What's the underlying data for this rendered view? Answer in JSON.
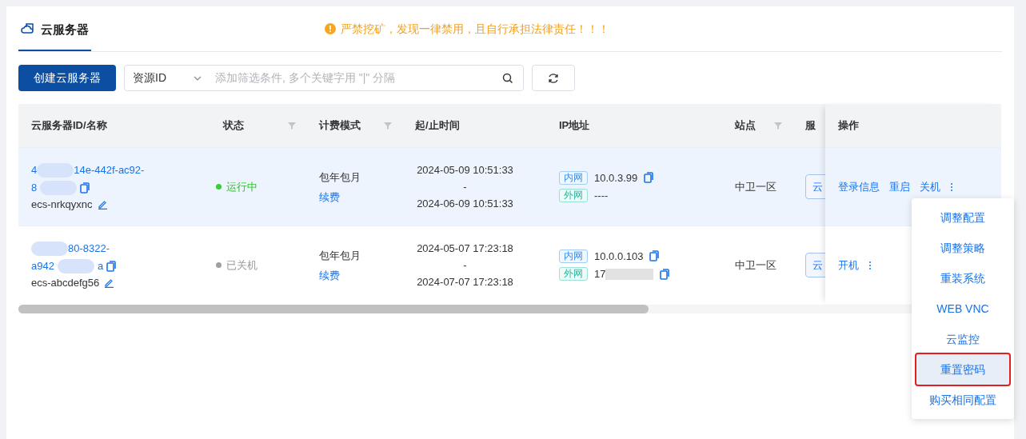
{
  "tab": {
    "label": "云服务器",
    "selected": true
  },
  "notice": "严禁挖矿，发现一律禁用，且自行承担法律责任！！！",
  "toolbar": {
    "create_button": "创建云服务器",
    "filter_key": "资源ID",
    "search_placeholder": "添加筛选条件, 多个关键字用 \"|\" 分隔"
  },
  "table": {
    "columns": [
      {
        "label": "云服务器ID/名称"
      },
      {
        "label": "状态",
        "filter": true
      },
      {
        "label": "计费模式",
        "filter": true
      },
      {
        "label": "起/止时间"
      },
      {
        "label": "IP地址"
      },
      {
        "label": "站点",
        "filter": true
      },
      {
        "label": "服"
      },
      {
        "label": "操作"
      }
    ],
    "rows": [
      {
        "id_line1": [
          {
            "kind": "text",
            "text": "4"
          },
          {
            "kind": "redacted"
          },
          {
            "kind": "text",
            "text": "14e-442f-ac92-"
          }
        ],
        "id_line2": [
          {
            "kind": "text",
            "text": "8"
          },
          {
            "kind": "redacted"
          }
        ],
        "name": "ecs-nrkqyxnc",
        "status": "运行中",
        "running": true,
        "billing": "包年包月",
        "renew": "续费",
        "start": "2024-05-09 10:51:33",
        "dash": "-",
        "end": "2024-06-09 10:51:33",
        "ips": [
          {
            "tag": "内网",
            "kind": "inner",
            "value": "10.0.3.99",
            "copy": true
          },
          {
            "tag": "外网",
            "kind": "outer",
            "value": "----"
          }
        ],
        "site": "中卫一区",
        "col7": "云",
        "actions": [
          "登录信息",
          "重启",
          "关机"
        ],
        "hovered": true
      },
      {
        "id_line1": [
          {
            "kind": "redacted"
          },
          {
            "kind": "text",
            "text": "80-8322-"
          }
        ],
        "id_line2": [
          {
            "kind": "text",
            "text": "a942"
          },
          {
            "kind": "redacted"
          },
          {
            "kind": "text",
            "text": "a"
          }
        ],
        "name": "ecs-abcdefg56",
        "status": "已关机",
        "running": false,
        "billing": "包年包月",
        "renew": "续费",
        "start": "2024-05-07 17:23:18",
        "dash": "-",
        "end": "2024-07-07 17:23:18",
        "ips": [
          {
            "tag": "内网",
            "kind": "inner",
            "value": "10.0.0.103",
            "copy": true
          },
          {
            "tag": "外网",
            "kind": "outer",
            "value": "17",
            "redacted": true,
            "copy": true
          }
        ],
        "site": "中卫一区",
        "col7": "云",
        "actions": [
          "开机"
        ],
        "hovered": false
      }
    ]
  },
  "menu": [
    {
      "label": "调整配置",
      "highlighted": false
    },
    {
      "label": "调整策略",
      "highlighted": false
    },
    {
      "label": "重装系统",
      "highlighted": false
    },
    {
      "label": "WEB VNC",
      "highlighted": false
    },
    {
      "label": "云监控",
      "highlighted": false
    },
    {
      "label": "重置密码",
      "highlighted": true
    },
    {
      "label": "购买相同配置",
      "highlighted": false
    }
  ]
}
